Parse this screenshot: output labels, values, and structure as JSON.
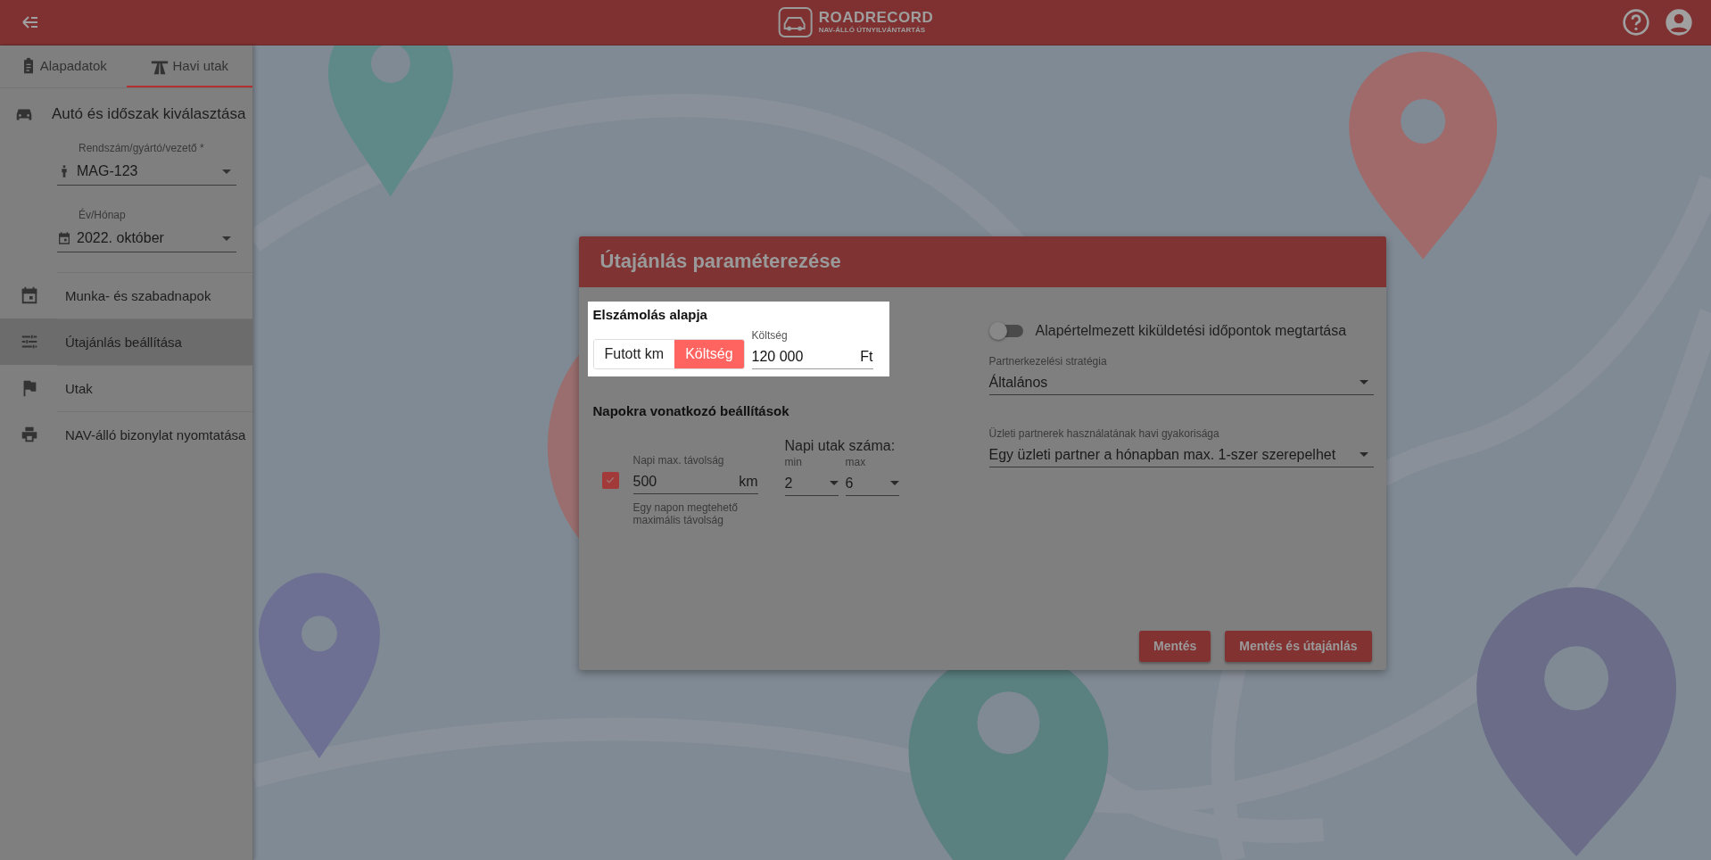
{
  "header": {
    "logo_title": "ROADRECORD",
    "logo_subtitle": "NAV-ÁLLÓ ÚTNYILVÁNTARTÁS"
  },
  "sidebar": {
    "tabs": [
      {
        "label": "Alapadatok",
        "selected": false
      },
      {
        "label": "Havi utak",
        "selected": true
      }
    ],
    "section_title": "Autó és időszak kiválasztása",
    "fields": [
      {
        "label": "Rendszám/gyártó/vezető *",
        "value": "MAG-123"
      },
      {
        "label": "Év/Hónap",
        "value": "2022. október"
      }
    ],
    "items": [
      {
        "label": "Munka- és szabadnapok",
        "selected": false
      },
      {
        "label": "Útajánlás beállítása",
        "selected": true
      },
      {
        "label": "Utak",
        "selected": false
      },
      {
        "label": "NAV-álló bizonylat nyomtatása",
        "selected": false
      }
    ]
  },
  "dialog": {
    "title": "Útajánlás paraméterezése",
    "billing": {
      "title": "Elszámolás alapja",
      "options": [
        {
          "label": "Futott km",
          "selected": false
        },
        {
          "label": "Költség",
          "selected": true
        }
      ],
      "cost_field": {
        "label": "Költség",
        "value": "120 000",
        "suffix": "Ft"
      }
    },
    "daily": {
      "title": "Napokra vonatkozó beállítások",
      "max_distance": {
        "checked": true,
        "label": "Napi max. távolság",
        "value": "500",
        "suffix": "km",
        "hint": "Egy napon megtehető maximális távolság"
      },
      "trips": {
        "title": "Napi utak száma:",
        "selects": [
          {
            "label": "min",
            "value": "2"
          },
          {
            "label": "max",
            "value": "6"
          }
        ]
      }
    },
    "default_times": {
      "on": false,
      "label": "Alapértelmezett kiküldetési időpontok megtartása"
    },
    "selects": [
      {
        "label": "Partnerkezelési stratégia",
        "value": "Általános"
      },
      {
        "label": "Üzleti partnerek használatának havi gyakorisága",
        "value": "Egy üzleti partner a hónapban max. 1-szer szerepelhet"
      }
    ],
    "buttons": [
      "Mentés",
      "Mentés és útajánlás"
    ]
  }
}
